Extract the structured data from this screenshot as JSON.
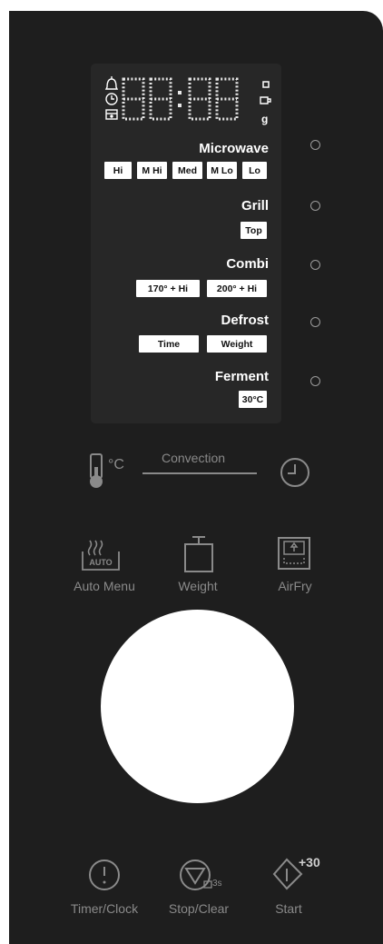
{
  "display": {
    "digits_placeholder": "88:88",
    "unit_g": "g"
  },
  "modes": {
    "microwave": {
      "title": "Microwave",
      "options": [
        "Hi",
        "M Hi",
        "Med",
        "M Lo",
        "Lo"
      ]
    },
    "grill": {
      "title": "Grill",
      "options": [
        "Top"
      ]
    },
    "combi": {
      "title": "Combi",
      "options": [
        "170° + Hi",
        "200° + Hi"
      ]
    },
    "defrost": {
      "title": "Defrost",
      "options": [
        "Time",
        "Weight"
      ]
    },
    "ferment": {
      "title": "Ferment",
      "options": [
        "30°C"
      ]
    }
  },
  "convection": {
    "label": "Convection",
    "temp_unit": "°C"
  },
  "function_buttons": {
    "auto_menu": {
      "label": "Auto Menu",
      "icon_text": "AUTO"
    },
    "weight": {
      "label": "Weight"
    },
    "airfry": {
      "label": "AirFry"
    }
  },
  "bottom_buttons": {
    "timer_clock": {
      "label": "Timer/Clock"
    },
    "stop_clear": {
      "label": "Stop/Clear",
      "lock_hint": "3s"
    },
    "start": {
      "label": "Start",
      "plus_text": "+30"
    }
  },
  "colors": {
    "panel": "#1e1e1e",
    "display": "#272727",
    "text_white": "#ffffff",
    "text_grey": "#8a8a8a"
  }
}
